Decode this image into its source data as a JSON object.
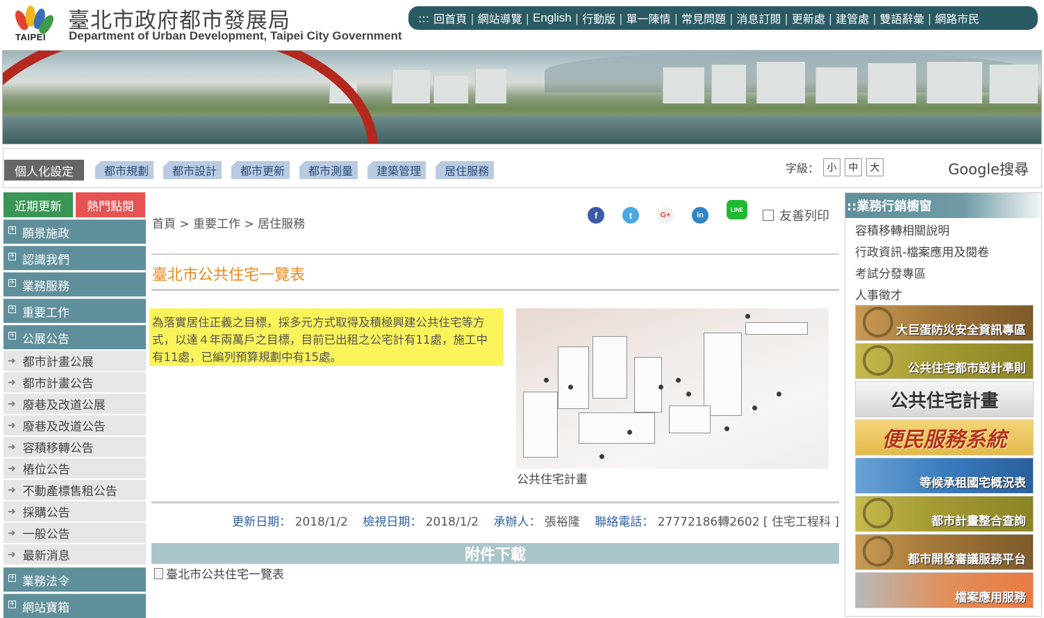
{
  "header": {
    "logo_word": "TAIPEI",
    "title": "臺北市政府都市發展局",
    "subtitle": "Department of Urban Development, Taipei City Government",
    "topnav_prefix": ":::",
    "topnav": [
      "回首頁",
      "網站導覽",
      "English",
      "行動版",
      "單一陳情",
      "常見問題",
      "消息訂閱",
      "更新處",
      "建管處",
      "雙語辭彙",
      "網路市民"
    ]
  },
  "subnav": {
    "personal": "個人化設定",
    "tabs": [
      "都市規劃",
      "都市設計",
      "都市更新",
      "都市測量",
      "建築管理",
      "居住服務"
    ],
    "fontsize_label": "字級：",
    "fontsize_options": [
      "小",
      "中",
      "大"
    ],
    "google_search": "Google搜尋"
  },
  "left": {
    "tab_recent": "近期更新",
    "tab_hot": "熱門點閱",
    "menu_top": [
      "願景施政",
      "認識我們",
      "業務服務",
      "重要工作",
      "公展公告"
    ],
    "submenu": [
      "都市計畫公展",
      "都市計畫公告",
      "廢巷及改道公展",
      "廢巷及改道公告",
      "容積移轉公告",
      "樁位公告",
      "不動產標售租公告",
      "採購公告",
      "一般公告",
      "最新消息"
    ],
    "menu_bottom": [
      "業務法令",
      "網站寶箱"
    ]
  },
  "main": {
    "breadcrumb": "首頁 > 重要工作 > 居住服務",
    "share_icons": [
      "facebook-icon",
      "twitter-icon",
      "google-plus-icon",
      "linkedin-icon",
      "line-icon"
    ],
    "line_label": "LINE",
    "print_label": "友善列印",
    "page_title": "臺北市公共住宅一覽表",
    "intro": "為落實居住正義之目標，採多元方式取得及積極興建公共住宅等方式，以達４年兩萬戶之目標，目前已出租之公宅計有11處，施工中有11處，已編列預算規劃中有15處。",
    "image_caption": "公共住宅計畫",
    "meta": {
      "updated_label": "更新日期：",
      "updated": "2018/1/2",
      "viewed_label": "檢視日期：",
      "viewed": "2018/1/2",
      "handler_label": "承辦人：",
      "handler": "張裕隆",
      "phone_label": "聯絡電話：",
      "phone": "27772186轉2602 [ 住宅工程科 ]"
    },
    "attachments_label": "附件下載",
    "attachment": "臺北市公共住宅一覽表"
  },
  "right": {
    "title": "::業務行銷櫥窗",
    "links": [
      "容積移轉相關說明",
      "行政資訊-檔案應用及閱卷",
      "考試分發專區",
      "人事徵才"
    ],
    "banners": [
      "大巨蛋防災安全資訊專區",
      "公共住宅都市設計準則",
      "公共住宅計畫",
      "便民服務系統",
      "等候承租國宅概況表",
      "都市計畫整合查詢",
      "都市開發審議服務平台",
      "檔案應用服務"
    ]
  },
  "colors": {
    "topnav_bg": "#2a5a63",
    "menu_bg": "#5f8f9b",
    "title_orange": "#e8891e",
    "highlight_yellow": "#fbf35a",
    "recent_green": "#3a9655",
    "hot_red": "#e55353"
  }
}
